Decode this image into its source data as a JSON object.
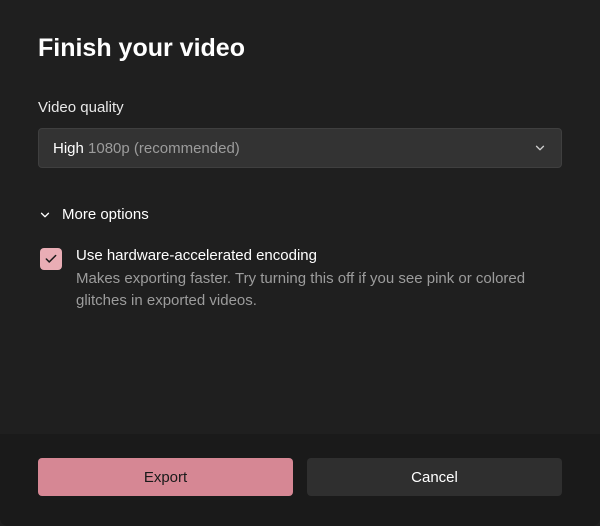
{
  "dialog": {
    "title": "Finish your video",
    "quality_label": "Video quality",
    "quality_value_strong": "High",
    "quality_value_muted": " 1080p (recommended)",
    "more_options_label": "More options",
    "option_checkbox_checked": true,
    "option_title": "Use hardware-accelerated encoding",
    "option_description": "Makes exporting faster. Try turning this off if you see pink or colored glitches in exported videos.",
    "export_label": "Export",
    "cancel_label": "Cancel"
  }
}
